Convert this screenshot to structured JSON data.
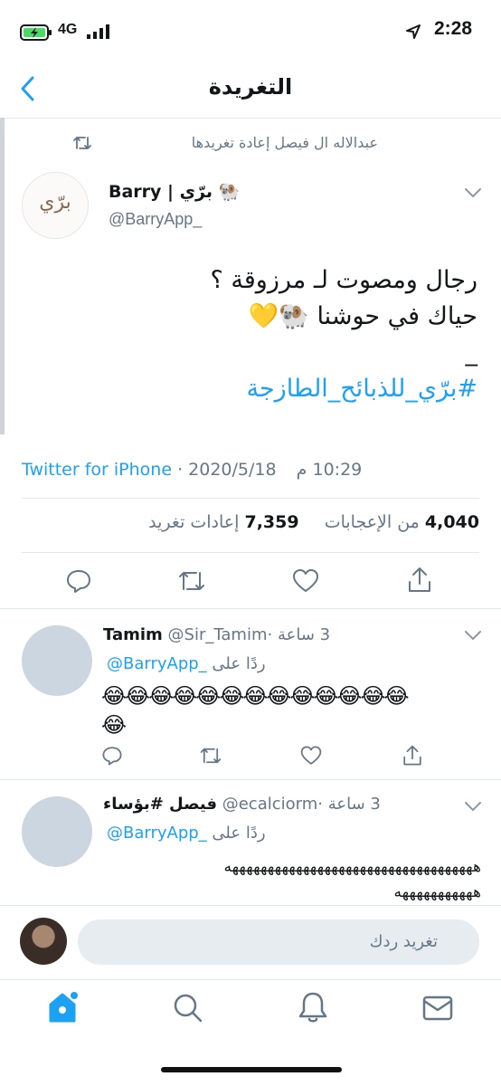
{
  "status_bar": {
    "network": "4G",
    "time": "2:28"
  },
  "header": {
    "title": "التغريدة"
  },
  "tweet": {
    "retweet_context": "عبدالاله ال فيصل إعادة تغريدها",
    "author_name": "Barry | برّي 🐏",
    "author_handle": "@BarryApp_",
    "avatar_logo_text": "برّي",
    "text_line1": "رجال ومصوت لـ مرزوقة ؟",
    "text_line2": "حياك في حوشنا 🐏💛",
    "text_line3": "_",
    "hashtag": "#برّي_للذبائح_الطازجة",
    "meta_time": "10:29 م",
    "meta_sep": " · ",
    "meta_date": "2020/5/18",
    "meta_source": "Twitter for iPhone",
    "retweets_count": "7,359",
    "retweets_label": "إعادات تغريد",
    "likes_count": "4,040",
    "likes_label": "من الإعجابات"
  },
  "replies": [
    {
      "name": "Tamim",
      "handle": "@Sir_Tamim",
      "time": "3 ساعة",
      "reply_to_prefix": "ردًا على",
      "reply_to_handle": "@BarryApp_",
      "text_line1": "😂😂😂😂😂😂😂😂😂😂😂😂😂",
      "text_line2": "😂"
    },
    {
      "name": "فيصل #بؤساء",
      "handle": "@ecalciorm",
      "time": "3 ساعة",
      "reply_to_prefix": "ردًا على",
      "reply_to_handle": "@BarryApp_",
      "text_line1": "هههههههههههههههههههههههههههههههههههه",
      "text_line2": "هههههههههههه"
    }
  ],
  "composer": {
    "placeholder": "تغريد ردك"
  },
  "icons": {
    "back": "chevron-left-icon",
    "retweet": "retweet-icon",
    "reply": "reply-icon",
    "like": "heart-icon",
    "share": "share-icon",
    "home": "home-icon",
    "search": "search-icon",
    "notifications": "bell-icon",
    "messages": "mail-icon"
  },
  "colors": {
    "accent": "#1da1f2",
    "secondary_text": "#657786",
    "divider": "#e1e8ed"
  }
}
